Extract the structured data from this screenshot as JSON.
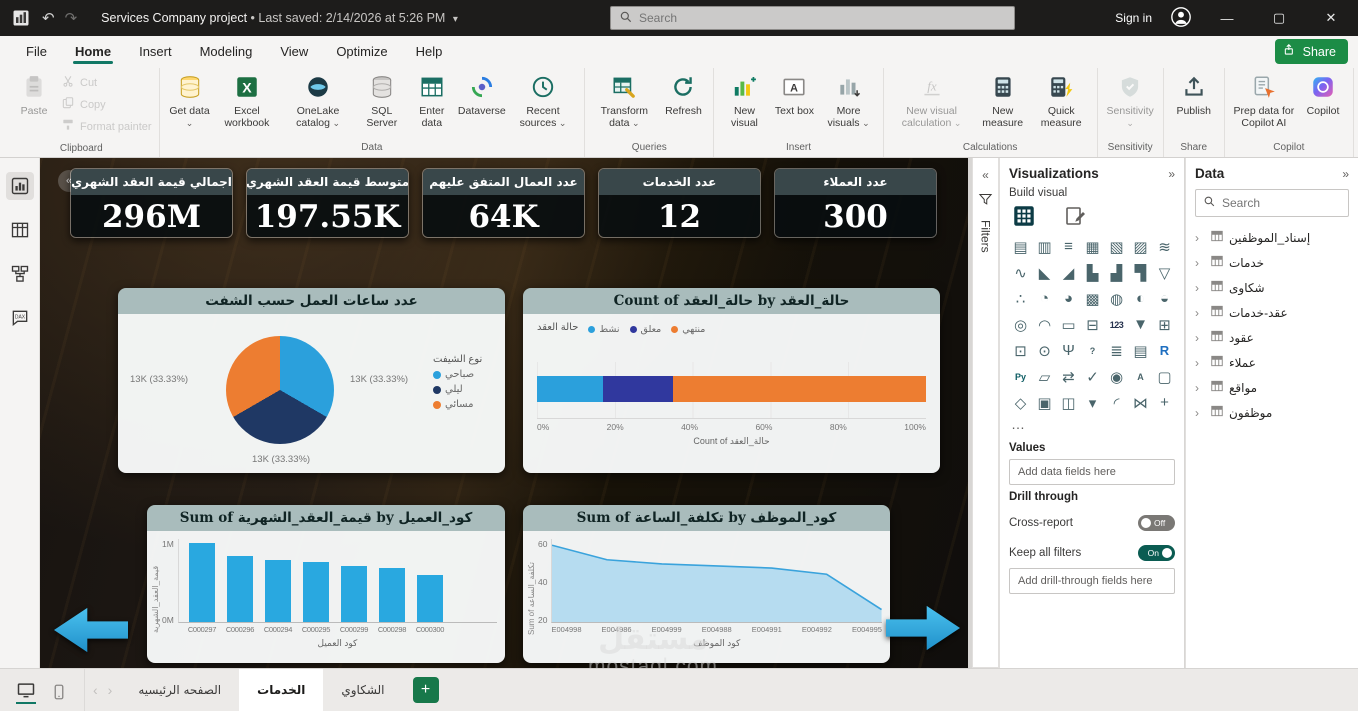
{
  "titlebar": {
    "title": "Services Company project",
    "saved": "•  Last saved: 2/14/2026 at 5:26 PM",
    "search_placeholder": "Search",
    "sign_in": "Sign in",
    "minimize": "—",
    "maximize": "▢",
    "close": "✕"
  },
  "menubar": {
    "items": [
      "File",
      "Home",
      "Insert",
      "Modeling",
      "View",
      "Optimize",
      "Help"
    ],
    "active": "Home",
    "share_label": "Share"
  },
  "ribbon": {
    "groups": [
      {
        "label": "Clipboard",
        "buttons": [
          {
            "label": "Paste",
            "icon": "paste",
            "disabled": true
          },
          {
            "label": "Cut",
            "icon": "cut",
            "small": true,
            "disabled": true
          },
          {
            "label": "Copy",
            "icon": "copy",
            "small": true,
            "disabled": true
          },
          {
            "label": "Format painter",
            "icon": "format-painter",
            "small": true,
            "disabled": true
          }
        ]
      },
      {
        "label": "Data",
        "buttons": [
          {
            "label": "Get data",
            "icon": "database",
            "dropdown": true
          },
          {
            "label": "Excel workbook",
            "icon": "excel"
          },
          {
            "label": "OneLake catalog",
            "icon": "onelake",
            "dropdown": true
          },
          {
            "label": "SQL Server",
            "icon": "sql"
          },
          {
            "label": "Enter data",
            "icon": "enter-data"
          },
          {
            "label": "Dataverse",
            "icon": "dataverse"
          },
          {
            "label": "Recent sources",
            "icon": "recent",
            "dropdown": true
          }
        ]
      },
      {
        "label": "Queries",
        "buttons": [
          {
            "label": "Transform data",
            "icon": "transform",
            "dropdown": true
          },
          {
            "label": "Refresh",
            "icon": "refresh"
          }
        ]
      },
      {
        "label": "Insert",
        "buttons": [
          {
            "label": "New visual",
            "icon": "new-visual"
          },
          {
            "label": "Text box",
            "icon": "textbox"
          },
          {
            "label": "More visuals",
            "icon": "more-visuals",
            "dropdown": true
          }
        ]
      },
      {
        "label": "Calculations",
        "buttons": [
          {
            "label": "New visual calculation",
            "icon": "fx",
            "dropdown": true,
            "disabled": true
          },
          {
            "label": "New measure",
            "icon": "measure"
          },
          {
            "label": "Quick measure",
            "icon": "quick-measure"
          }
        ]
      },
      {
        "label": "Sensitivity",
        "buttons": [
          {
            "label": "Sensitivity",
            "icon": "sensitivity",
            "dropdown": true,
            "disabled": true
          }
        ]
      },
      {
        "label": "Share",
        "buttons": [
          {
            "label": "Publish",
            "icon": "publish"
          }
        ]
      },
      {
        "label": "Copilot",
        "buttons": [
          {
            "label": "Prep data for Copilot AI",
            "icon": "prep-copilot"
          },
          {
            "label": "Copilot",
            "icon": "copilot"
          }
        ]
      }
    ]
  },
  "canvas": {
    "kpi_cards": [
      {
        "title": "اجمالي قيمة العقد الشهري",
        "value": "296M"
      },
      {
        "title": "متوسط قيمة العقد الشهري",
        "value": "197.55K"
      },
      {
        "title": "عدد العمال المتفق عليهم",
        "value": "64K"
      },
      {
        "title": "عدد الخدمات",
        "value": "12"
      },
      {
        "title": "عدد العملاء",
        "value": "300"
      }
    ],
    "watermark_line1": "مستقل",
    "watermark_line2": "mostaql.com"
  },
  "chart_data": [
    {
      "type": "pie",
      "title": "عدد ساعات العمل حسب الشفت",
      "legend_title": "نوع الشيفت",
      "slices": [
        {
          "label": "صباحي",
          "value": 13000,
          "display": "13K (33.33%)",
          "color": "#2ba0dc"
        },
        {
          "label": "ليلي",
          "value": 13000,
          "display": "13K (33.33%)",
          "color": "#1f3864"
        },
        {
          "label": "مسائي",
          "value": 13000,
          "display": "13K (33.33%)",
          "color": "#ed7d31"
        }
      ]
    },
    {
      "type": "stacked-bar-100",
      "title": "Count of حالة_العقد by حالة_العقد",
      "legend_title": "حالة العقد",
      "xlabel": "Count of حالة_العقد",
      "x_ticks": [
        "0%",
        "20%",
        "40%",
        "60%",
        "80%",
        "100%"
      ],
      "segments": [
        {
          "label": "نشط",
          "pct": 17,
          "color": "#2ba0dc"
        },
        {
          "label": "معلق",
          "pct": 18,
          "color": "#30389e"
        },
        {
          "label": "منتهي",
          "pct": 65,
          "color": "#ed7d31"
        }
      ]
    },
    {
      "type": "bar",
      "title": "Sum of قيمة_العقد_الشهرية by كود_العميل",
      "categories": [
        "C000297",
        "C000296",
        "C000294",
        "C000295",
        "C000299",
        "C000298",
        "C000300"
      ],
      "values": [
        0.95,
        0.8,
        0.75,
        0.72,
        0.68,
        0.65,
        0.57
      ],
      "ylim": [
        0,
        1
      ],
      "y_ticks": [
        "1M",
        "0M"
      ],
      "ylabel": "قيمة_العقد_الشهرية",
      "xlabel": "كود العميل",
      "bar_color": "#29a8e0"
    },
    {
      "type": "area",
      "title": "Sum of تكلفة_الساعة by كود_الموظف",
      "categories": [
        "E004998",
        "E004986",
        "E004999",
        "E004988",
        "E004991",
        "E004992",
        "E004995"
      ],
      "values": [
        57,
        50,
        48,
        47,
        46,
        43,
        26
      ],
      "ylim": [
        20,
        60
      ],
      "y_ticks": [
        "60",
        "40",
        "20"
      ],
      "ylabel": "Sum of تكلفة_الساعة",
      "xlabel": "كود الموظف",
      "line_color": "#3aa3dc",
      "fill_color": "#a8d6ef"
    }
  ],
  "filters_panel": {
    "label": "Filters"
  },
  "visualizations": {
    "title": "Visualizations",
    "build_label": "Build visual",
    "icons": [
      "stacked-bar-chart|▤",
      "stacked-column-chart|▥",
      "clustered-bar-chart|≡",
      "clustered-column-chart|▦",
      "100-stacked-bar-chart|▧",
      "100-stacked-column-chart|▨",
      "ribbon-chart|≋",
      "line-chart|∿",
      "area-chart|◣",
      "stacked-area-chart|◢",
      "line-and-stacked-column-chart|▙",
      "line-and-clustered-column-chart|▟",
      "waterfall-chart|▜",
      "funnel-chart|▽",
      "scatter-chart|∴",
      "pie-chart|◔",
      "donut-chart|◕",
      "treemap|▩",
      "map|◍",
      "filled-map|◐",
      "shape-map|◒",
      "azure-map|◎",
      "gauge|◠",
      "card|▭",
      "multi-row-card|⊟",
      "kpi|123",
      "slicer|▼",
      "table|⊞",
      "matrix|⊡",
      "key-influencers|⊙",
      "decomposition-tree|Ψ",
      "qna|?",
      "smart-narrative|≣",
      "paginated-report|▤",
      "r-script-visual|R",
      "python-visual|Py",
      "power-apps|▱",
      "power-automate|⇄",
      "metrics|✓",
      "arcgis-map|◉",
      "text-box-visual|A",
      "button|▢",
      "shape|◇",
      "image|▣",
      "new-card|◫",
      "new-slicer|▾",
      "radial-gauge|◜",
      "hierarchy-slicer|⋈",
      "get-more-visuals|+"
    ],
    "more": "…",
    "values_label": "Values",
    "add_fields": "Add data fields here",
    "drill_through_label": "Drill through",
    "cross_report": {
      "label": "Cross-report",
      "state": "Off"
    },
    "keep_all_filters": {
      "label": "Keep all filters",
      "state": "On"
    },
    "add_drill_fields": "Add drill-through fields here"
  },
  "data_panel": {
    "title": "Data",
    "search_placeholder": "Search",
    "tables": [
      "إسناد_الموظفين",
      "خدمات",
      "شكاوى",
      "عقد-خدمات",
      "عقود",
      "عملاء",
      "مواقع",
      "موظفون"
    ]
  },
  "pagebar": {
    "tabs": [
      "الصفحه الرئيسيه",
      "الخدمات",
      "الشكاوي"
    ],
    "active": "الخدمات",
    "add_label": "+"
  }
}
